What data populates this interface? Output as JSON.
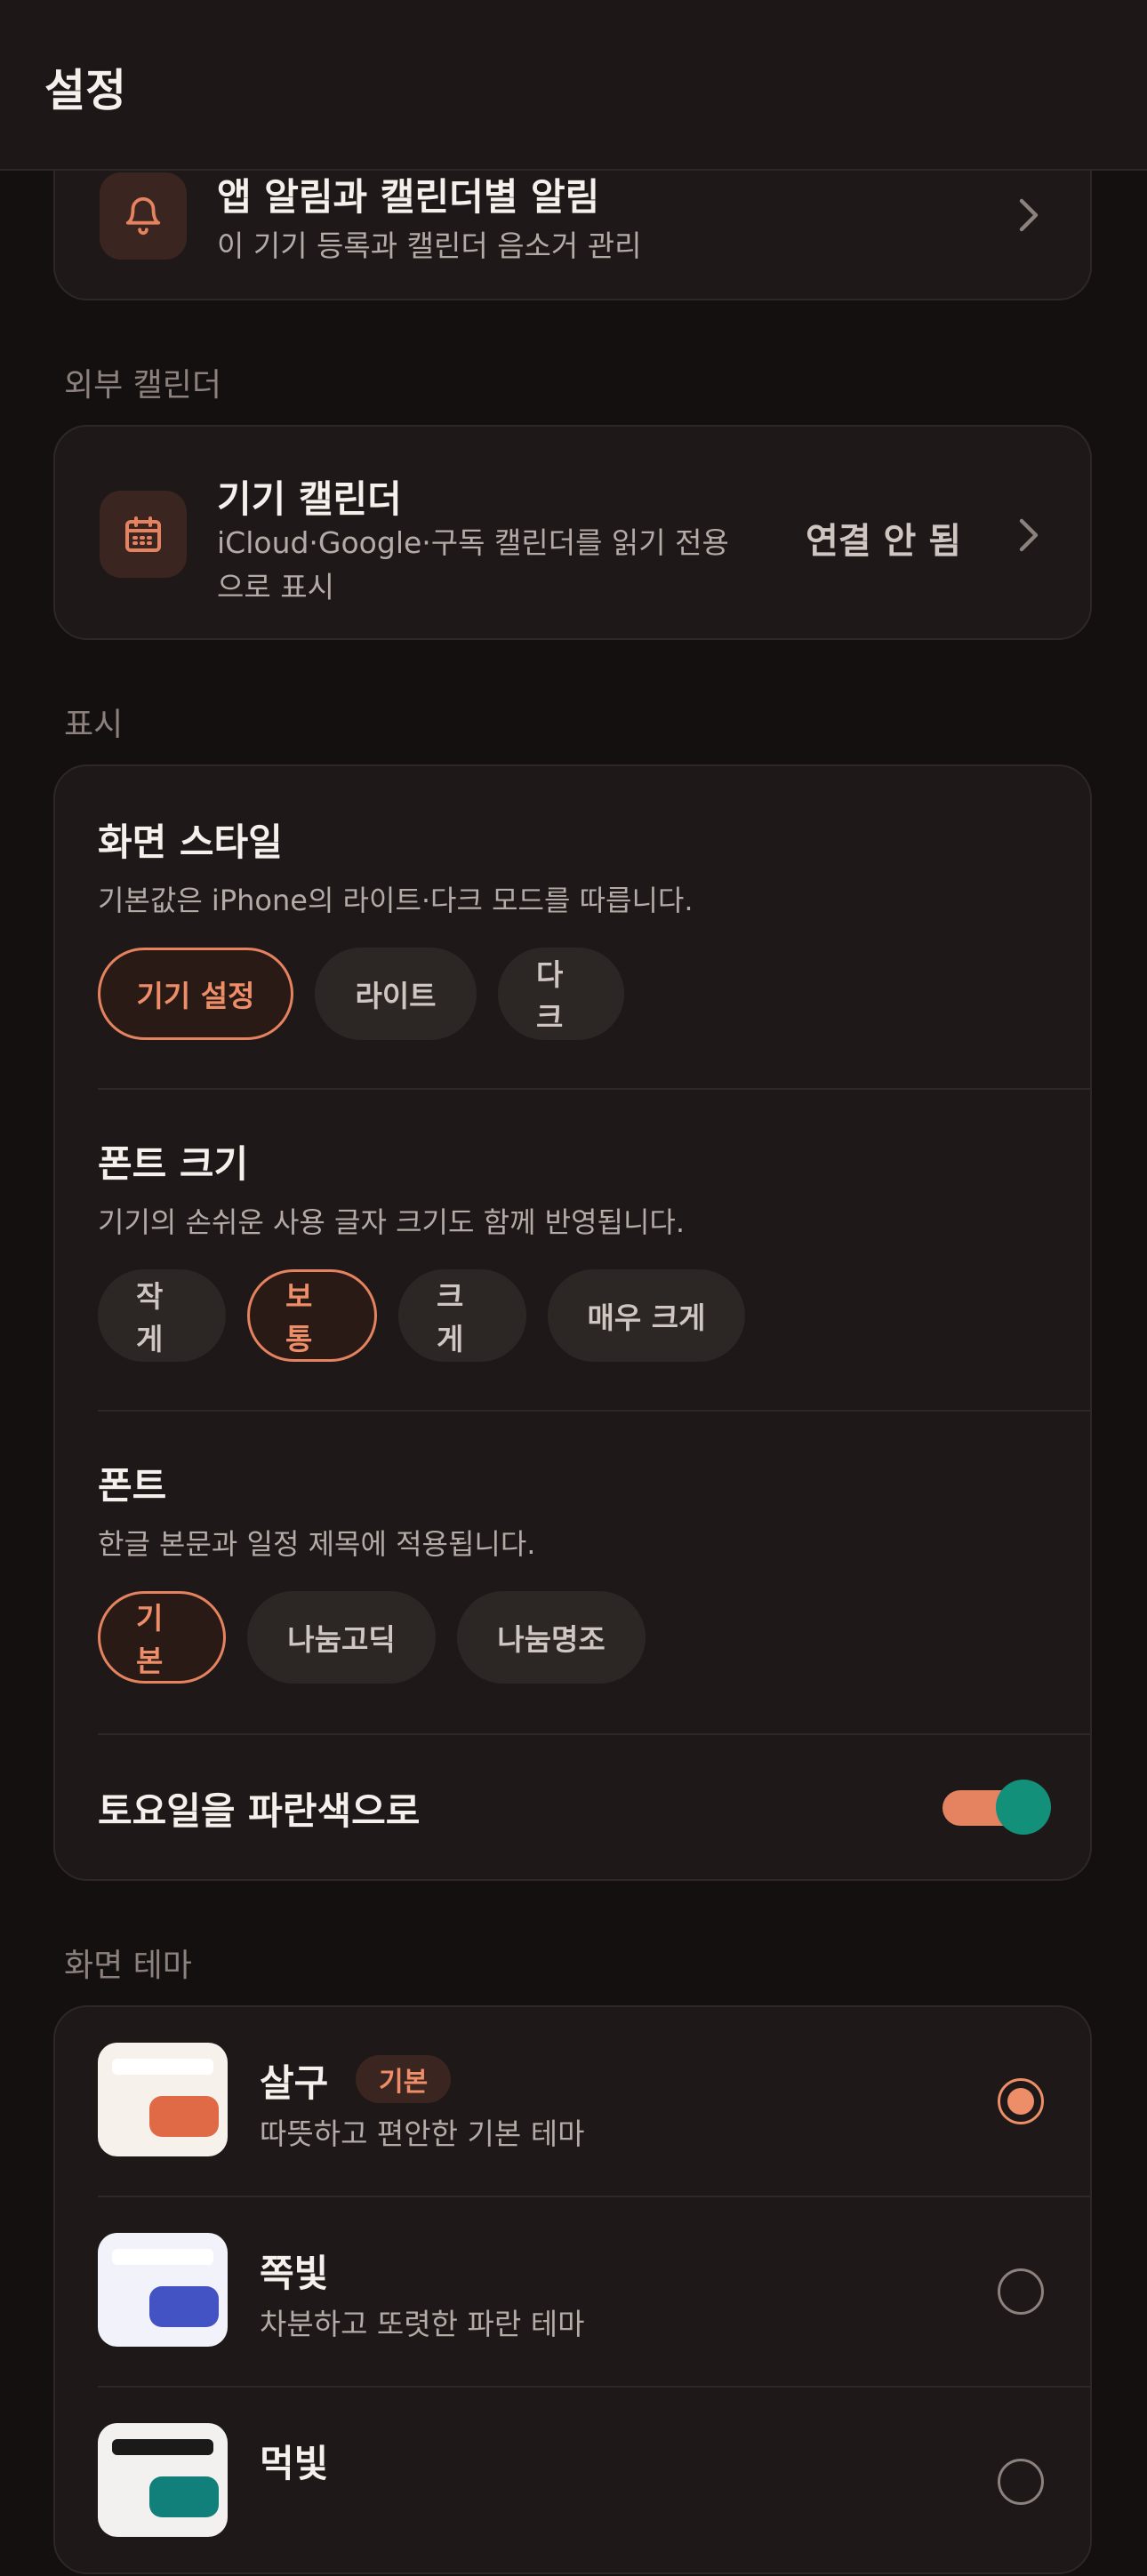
{
  "header": {
    "title": "설정"
  },
  "notifications_row": {
    "title": "앱 알림과 캘린더별 알림",
    "subtitle": "이 기기 등록과 캘린더 음소거 관리",
    "icon": "bell-icon"
  },
  "external_calendar": {
    "section_label": "외부 캘린더",
    "device_calendar": {
      "title": "기기 캘린더",
      "subtitle_line1": "iCloud·Google·구독 캘린더를 읽기 전용",
      "subtitle_line2": "으로 표시",
      "status": "연결 안 됨",
      "icon": "calendar-icon"
    }
  },
  "display": {
    "section_label": "표시",
    "screen_style": {
      "title": "화면 스타일",
      "subtitle": "기본값은 iPhone의 라이트·다크 모드를 따릅니다.",
      "options": [
        "기기 설정",
        "라이트",
        "다크"
      ],
      "selected": "기기 설정"
    },
    "font_size": {
      "title": "폰트 크기",
      "subtitle": "기기의 손쉬운 사용 글자 크기도 함께 반영됩니다.",
      "options": [
        "작게",
        "보통",
        "크게",
        "매우 크게"
      ],
      "selected": "보통"
    },
    "font": {
      "title": "폰트",
      "subtitle": "한글 본문과 일정 제목에 적용됩니다.",
      "options": [
        "기본",
        "나눔고딕",
        "나눔명조"
      ],
      "selected": "기본"
    },
    "saturday_blue": {
      "label": "토요일을 파란색으로",
      "enabled": true
    }
  },
  "themes": {
    "section_label": "화면 테마",
    "items": [
      {
        "name": "살구",
        "badge": "기본",
        "desc": "따뜻하고 편안한 기본 테마",
        "selected": true
      },
      {
        "name": "쪽빛",
        "badge": "",
        "desc": "차분하고 또렷한 파란 테마",
        "selected": false
      },
      {
        "name": "먹빛",
        "badge": "",
        "desc": "",
        "selected": false
      }
    ]
  },
  "colors": {
    "accent": "#e5825f",
    "toggle_knob": "#12907a",
    "background": "#151010",
    "card": "#1e1918"
  }
}
